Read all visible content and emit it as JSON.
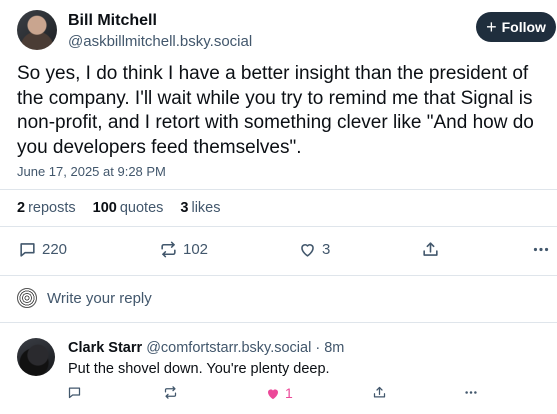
{
  "post": {
    "author_name": "Bill Mitchell",
    "author_handle": "@askbillmitchell.bsky.social",
    "follow_label": "Follow",
    "text": "So yes, I do think I have a better insight than the president of the company. I'll wait while you try to remind me that Signal is non-profit, and I retort with something clever like \"And how do you developers feed themselves\".",
    "date": "June 17, 2025 at 9:28 PM",
    "stats": {
      "reposts_count": "2",
      "reposts_label": "reposts",
      "quotes_count": "100",
      "quotes_label": "quotes",
      "likes_count": "3",
      "likes_label": "likes"
    },
    "actions": {
      "reply_count": "220",
      "repost_count": "102",
      "like_count": "3"
    }
  },
  "reply_box": {
    "placeholder": "Write your reply"
  },
  "reply": {
    "author_name": "Clark Starr",
    "author_handle": "@comfortstarr.bsky.social",
    "separator": "·",
    "time": "8m",
    "text": "Put the shovel down. You're plenty deep.",
    "like_count": "1"
  },
  "colors": {
    "follow_bg": "#1f2e3d",
    "muted_text": "#42576c",
    "liked": "#ec4899",
    "divider": "#dfe5eb"
  }
}
